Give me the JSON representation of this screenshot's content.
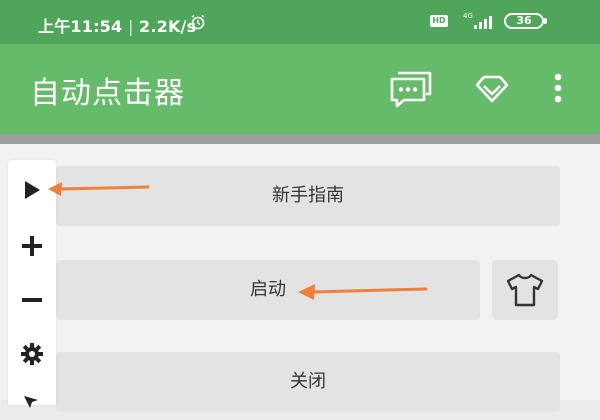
{
  "status_bar": {
    "time": "上午11:54",
    "speed": "2.2K/s",
    "hd_label": "HD",
    "network_label": "4G",
    "battery": "36",
    "alarm_icon": "alarm-icon"
  },
  "app_bar": {
    "title": "自动点击器",
    "icons": [
      "chat-icon",
      "diamond-icon",
      "more-vert-icon"
    ]
  },
  "toolbar": {
    "icons": [
      "play-icon",
      "plus-icon",
      "minus-icon",
      "gear-icon",
      "cursor-icon"
    ]
  },
  "buttons": {
    "guide_label": "新手指南",
    "start_label": "启动",
    "close_label": "关闭",
    "skin_icon": "tshirt-icon"
  },
  "colors": {
    "status_bar": "#4fa55a",
    "app_bar": "#66bb6a",
    "arrow": "#f07f3c",
    "button_bg": "#e3e3e3"
  }
}
